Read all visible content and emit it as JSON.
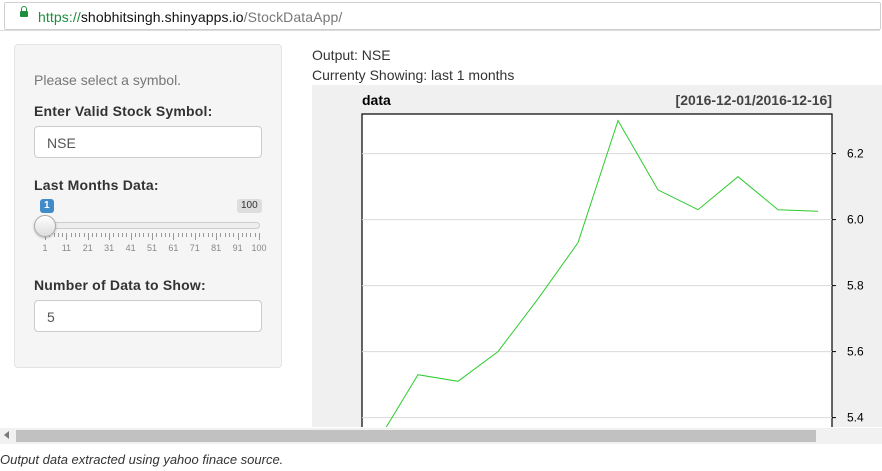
{
  "browser": {
    "url_scheme": "https://",
    "url_host": "shobhitsingh.shinyapps.io",
    "url_path": "/StockDataApp/"
  },
  "sidebar": {
    "hint": "Please select a symbol.",
    "symbol_label": "Enter Valid Stock Symbol:",
    "symbol_value": "NSE",
    "months_label": "Last Months Data:",
    "slider": {
      "value": 1,
      "min": 1,
      "max": 100,
      "min_badge": "1",
      "max_badge": "100",
      "tick_labels": [
        "1",
        "11",
        "21",
        "31",
        "41",
        "51",
        "61",
        "71",
        "81",
        "91",
        "100"
      ]
    },
    "count_label": "Number of Data to Show:",
    "count_value": "5"
  },
  "main": {
    "output_text": "Output: NSE",
    "showing_text": "Currenty Showing: last 1 months"
  },
  "chart_data": {
    "type": "line",
    "title": "data",
    "date_range": "[2016-12-01/2016-12-16]",
    "ylim": [
      5.32,
      6.32
    ],
    "y_ticks": [
      "6.2",
      "6.0",
      "5.8",
      "5.6",
      "5.4"
    ],
    "grid": true,
    "series": [
      {
        "color": "#2ecc2e",
        "values": [
          5.33,
          5.53,
          5.51,
          5.6,
          5.76,
          5.93,
          6.3,
          6.09,
          6.03,
          6.13,
          6.03,
          6.025
        ]
      }
    ]
  },
  "scrollbar": {},
  "footer": "Output data extracted using yahoo finace source."
}
